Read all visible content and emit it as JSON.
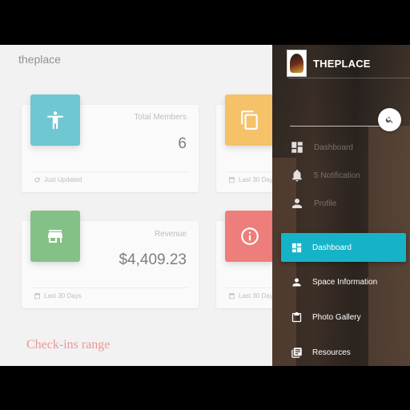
{
  "app": {
    "title": "theplace"
  },
  "cards": [
    {
      "label": "Total Members",
      "value": "6",
      "footer": "Just Updated",
      "color": "#22aabb",
      "icon": "accessibility-icon",
      "footer_icon": "refresh-icon"
    },
    {
      "label": "",
      "value": "",
      "footer": "Last 30 Days",
      "color": "#f0a01a",
      "icon": "copy-icon",
      "footer_icon": "calendar-icon"
    },
    {
      "label": "Revenue",
      "value": "$4,409.23",
      "footer": "Last 30 Days",
      "color": "#43a047",
      "icon": "store-icon",
      "footer_icon": "calendar-icon"
    },
    {
      "label": "",
      "value": "",
      "footer": "Last 30 Days",
      "color": "#e53935",
      "icon": "info-icon",
      "footer_icon": "calendar-icon"
    }
  ],
  "checkins": {
    "title": "Check-ins range"
  },
  "drawer": {
    "brand": "THEPLACE",
    "accent": "#16b3c8",
    "faded_items": [
      {
        "label": "Dashboard",
        "icon": "dashboard-icon"
      },
      {
        "label": "5  Notification",
        "icon": "bell-icon"
      },
      {
        "label": "Profile",
        "icon": "person-icon"
      }
    ],
    "nav": [
      {
        "label": "Dashboard",
        "icon": "dashboard-icon",
        "active": true
      },
      {
        "label": "Space Information",
        "icon": "person-icon",
        "active": false
      },
      {
        "label": "Photo Gallery",
        "icon": "clipboard-icon",
        "active": false
      },
      {
        "label": "Resources",
        "icon": "library-icon",
        "active": false
      }
    ]
  }
}
